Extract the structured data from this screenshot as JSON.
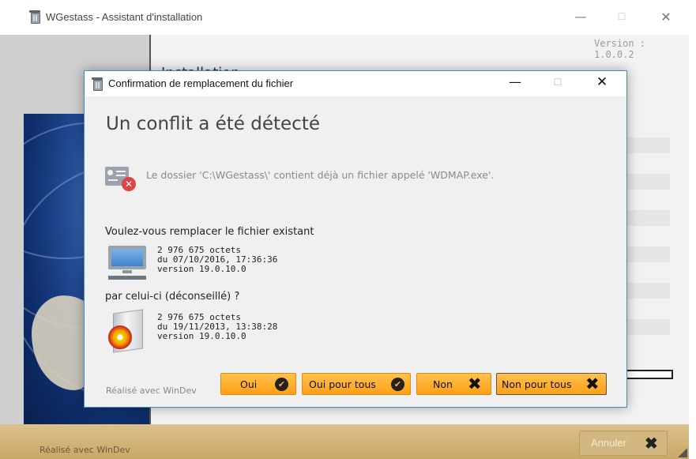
{
  "background_window": {
    "title": "WGestass - Assistant d'installation",
    "version": "Version : 1.0.0.2",
    "install_heading": "Installation",
    "footer": "Réalisé avec WinDev",
    "cancel_label": "Annuler",
    "controls": {
      "minimize": "—",
      "maximize": "☐",
      "close": "✕"
    }
  },
  "dialog": {
    "title": "Confirmation de remplacement du fichier",
    "controls": {
      "minimize": "—",
      "maximize": "☐",
      "close": "✕"
    },
    "headline": "Un conflit a été détecté",
    "message": "Le dossier 'C:\\WGestass\\' contient déjà un fichier appelé 'WDMAP.exe'.",
    "question": "Voulez-vous remplacer le fichier existant",
    "existing_file": {
      "size": "2 976 675 octets",
      "date": "du 07/10/2016, 17:36:36",
      "version": "version 19.0.10.0"
    },
    "replacement_question": "par celui-ci (déconseillé) ?",
    "new_file": {
      "size": "2 976 675 octets",
      "date": "du 19/11/2013, 13:38:28",
      "version": "version 19.0.10.0"
    },
    "footer": "Réalisé avec WinDev",
    "buttons": {
      "yes": "Oui",
      "yes_all": "Oui pour tous",
      "no": "Non",
      "no_all": "Non pour tous"
    }
  },
  "colors": {
    "button_orange": "#ff9f16",
    "dialog_border": "#3d8ad0",
    "footer_tan": "#c9a866"
  },
  "icons": [
    "app-trash-icon",
    "conflict-folder-icon",
    "computer-icon",
    "install-box-icon",
    "check-icon",
    "x-icon"
  ]
}
